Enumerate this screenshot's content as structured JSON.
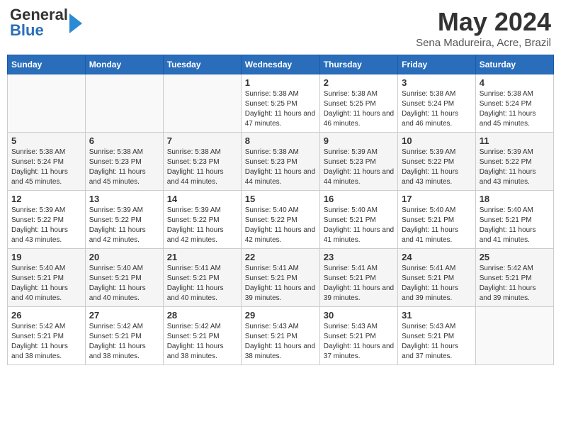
{
  "header": {
    "logo_general": "General",
    "logo_blue": "Blue",
    "month_year": "May 2024",
    "location": "Sena Madureira, Acre, Brazil"
  },
  "days_of_week": [
    "Sunday",
    "Monday",
    "Tuesday",
    "Wednesday",
    "Thursday",
    "Friday",
    "Saturday"
  ],
  "weeks": [
    [
      {
        "day": "",
        "info": ""
      },
      {
        "day": "",
        "info": ""
      },
      {
        "day": "",
        "info": ""
      },
      {
        "day": "1",
        "info": "Sunrise: 5:38 AM\nSunset: 5:25 PM\nDaylight: 11 hours and 47 minutes."
      },
      {
        "day": "2",
        "info": "Sunrise: 5:38 AM\nSunset: 5:25 PM\nDaylight: 11 hours and 46 minutes."
      },
      {
        "day": "3",
        "info": "Sunrise: 5:38 AM\nSunset: 5:24 PM\nDaylight: 11 hours and 46 minutes."
      },
      {
        "day": "4",
        "info": "Sunrise: 5:38 AM\nSunset: 5:24 PM\nDaylight: 11 hours and 45 minutes."
      }
    ],
    [
      {
        "day": "5",
        "info": "Sunrise: 5:38 AM\nSunset: 5:24 PM\nDaylight: 11 hours and 45 minutes."
      },
      {
        "day": "6",
        "info": "Sunrise: 5:38 AM\nSunset: 5:23 PM\nDaylight: 11 hours and 45 minutes."
      },
      {
        "day": "7",
        "info": "Sunrise: 5:38 AM\nSunset: 5:23 PM\nDaylight: 11 hours and 44 minutes."
      },
      {
        "day": "8",
        "info": "Sunrise: 5:38 AM\nSunset: 5:23 PM\nDaylight: 11 hours and 44 minutes."
      },
      {
        "day": "9",
        "info": "Sunrise: 5:39 AM\nSunset: 5:23 PM\nDaylight: 11 hours and 44 minutes."
      },
      {
        "day": "10",
        "info": "Sunrise: 5:39 AM\nSunset: 5:22 PM\nDaylight: 11 hours and 43 minutes."
      },
      {
        "day": "11",
        "info": "Sunrise: 5:39 AM\nSunset: 5:22 PM\nDaylight: 11 hours and 43 minutes."
      }
    ],
    [
      {
        "day": "12",
        "info": "Sunrise: 5:39 AM\nSunset: 5:22 PM\nDaylight: 11 hours and 43 minutes."
      },
      {
        "day": "13",
        "info": "Sunrise: 5:39 AM\nSunset: 5:22 PM\nDaylight: 11 hours and 42 minutes."
      },
      {
        "day": "14",
        "info": "Sunrise: 5:39 AM\nSunset: 5:22 PM\nDaylight: 11 hours and 42 minutes."
      },
      {
        "day": "15",
        "info": "Sunrise: 5:40 AM\nSunset: 5:22 PM\nDaylight: 11 hours and 42 minutes."
      },
      {
        "day": "16",
        "info": "Sunrise: 5:40 AM\nSunset: 5:21 PM\nDaylight: 11 hours and 41 minutes."
      },
      {
        "day": "17",
        "info": "Sunrise: 5:40 AM\nSunset: 5:21 PM\nDaylight: 11 hours and 41 minutes."
      },
      {
        "day": "18",
        "info": "Sunrise: 5:40 AM\nSunset: 5:21 PM\nDaylight: 11 hours and 41 minutes."
      }
    ],
    [
      {
        "day": "19",
        "info": "Sunrise: 5:40 AM\nSunset: 5:21 PM\nDaylight: 11 hours and 40 minutes."
      },
      {
        "day": "20",
        "info": "Sunrise: 5:40 AM\nSunset: 5:21 PM\nDaylight: 11 hours and 40 minutes."
      },
      {
        "day": "21",
        "info": "Sunrise: 5:41 AM\nSunset: 5:21 PM\nDaylight: 11 hours and 40 minutes."
      },
      {
        "day": "22",
        "info": "Sunrise: 5:41 AM\nSunset: 5:21 PM\nDaylight: 11 hours and 39 minutes."
      },
      {
        "day": "23",
        "info": "Sunrise: 5:41 AM\nSunset: 5:21 PM\nDaylight: 11 hours and 39 minutes."
      },
      {
        "day": "24",
        "info": "Sunrise: 5:41 AM\nSunset: 5:21 PM\nDaylight: 11 hours and 39 minutes."
      },
      {
        "day": "25",
        "info": "Sunrise: 5:42 AM\nSunset: 5:21 PM\nDaylight: 11 hours and 39 minutes."
      }
    ],
    [
      {
        "day": "26",
        "info": "Sunrise: 5:42 AM\nSunset: 5:21 PM\nDaylight: 11 hours and 38 minutes."
      },
      {
        "day": "27",
        "info": "Sunrise: 5:42 AM\nSunset: 5:21 PM\nDaylight: 11 hours and 38 minutes."
      },
      {
        "day": "28",
        "info": "Sunrise: 5:42 AM\nSunset: 5:21 PM\nDaylight: 11 hours and 38 minutes."
      },
      {
        "day": "29",
        "info": "Sunrise: 5:43 AM\nSunset: 5:21 PM\nDaylight: 11 hours and 38 minutes."
      },
      {
        "day": "30",
        "info": "Sunrise: 5:43 AM\nSunset: 5:21 PM\nDaylight: 11 hours and 37 minutes."
      },
      {
        "day": "31",
        "info": "Sunrise: 5:43 AM\nSunset: 5:21 PM\nDaylight: 11 hours and 37 minutes."
      },
      {
        "day": "",
        "info": ""
      }
    ]
  ]
}
